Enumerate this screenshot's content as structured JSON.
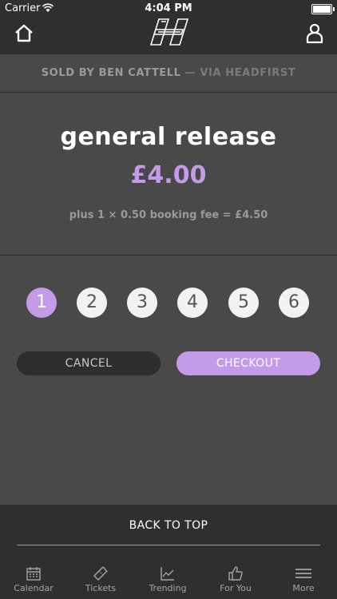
{
  "status_bar": {
    "carrier": "Carrier",
    "time": "4:04 PM"
  },
  "nav": {
    "icons": [
      "home-icon",
      "headfirst-logo",
      "profile-icon"
    ]
  },
  "seller": {
    "text": "SOLD BY BEN CATTELL",
    "via": " — VIA HEADFIRST"
  },
  "ticket": {
    "title": "general release",
    "price": "£4.00",
    "fee": "plus 1 × 0.50 booking fee = £4.50"
  },
  "quantity": {
    "options": [
      "1",
      "2",
      "3",
      "4",
      "5",
      "6"
    ],
    "selected": "1"
  },
  "actions": {
    "cancel": "CANCEL",
    "checkout": "CHECKOUT"
  },
  "footer": {
    "back_to_top": "BACK TO TOP"
  },
  "tabbar": {
    "items": [
      {
        "label": "Calendar",
        "icon": "calendar-icon"
      },
      {
        "label": "Tickets",
        "icon": "ticket-icon"
      },
      {
        "label": "Trending",
        "icon": "trending-icon"
      },
      {
        "label": "For You",
        "icon": "thumbs-up-icon"
      },
      {
        "label": "More",
        "icon": "menu-icon"
      }
    ]
  },
  "colors": {
    "accent": "#c49be8",
    "background": "#4a4949",
    "bar": "#2f2f2f"
  }
}
